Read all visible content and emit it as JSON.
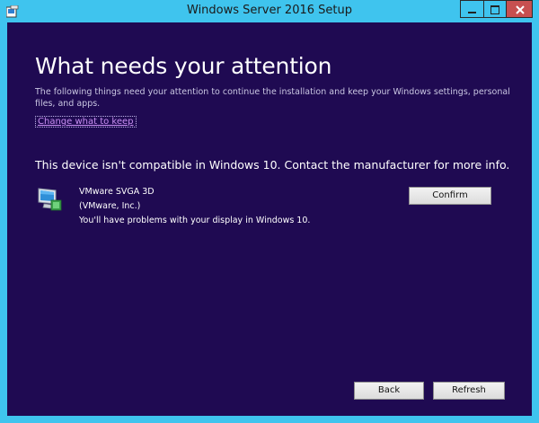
{
  "window": {
    "title": "Windows Server 2016 Setup"
  },
  "page": {
    "heading": "What needs your attention",
    "subtitle": "The following things need your attention to continue the installation and keep your Windows settings, personal files, and apps.",
    "change_link": "Change what to keep",
    "compat_message": "This device isn't compatible in Windows 10. Contact the manufacturer for more info."
  },
  "device": {
    "icon": "display-monitor-icon",
    "name": "VMware SVGA 3D",
    "vendor": "(VMware, Inc.)",
    "problem": "You'll have problems with your display in Windows 10.",
    "confirm_label": "Confirm"
  },
  "footer": {
    "back_label": "Back",
    "refresh_label": "Refresh"
  },
  "colors": {
    "title_bar": "#3fc4ee",
    "content_background": "#1f0a52",
    "close_button": "#c75050",
    "link": "#c98ff3"
  }
}
